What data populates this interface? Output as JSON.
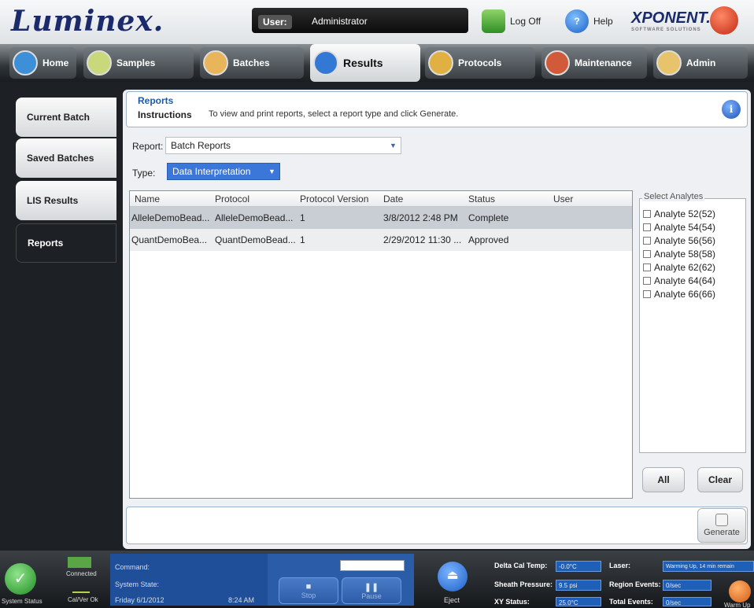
{
  "app": {
    "logo": "Luminex.",
    "xponent": "XPONENT.",
    "xponent_sub": "SOFTWARE SOLUTIONS"
  },
  "header": {
    "user_label": "User:",
    "user_value": "Administrator",
    "logoff": "Log Off",
    "help": "Help"
  },
  "nav": {
    "tabs": [
      {
        "label": "Home",
        "icon": "home-icon"
      },
      {
        "label": "Samples",
        "icon": "samples-icon"
      },
      {
        "label": "Batches",
        "icon": "batches-icon"
      },
      {
        "label": "Results",
        "icon": "results-chart-icon"
      },
      {
        "label": "Protocols",
        "icon": "protocols-icon"
      },
      {
        "label": "Maintenance",
        "icon": "maintenance-tools-icon"
      },
      {
        "label": "Admin",
        "icon": "admin-user-icon"
      }
    ]
  },
  "sidebar": {
    "items": [
      {
        "label": "Current Batch"
      },
      {
        "label": "Saved Batches"
      },
      {
        "label": "LIS Results"
      },
      {
        "label": "Reports"
      }
    ]
  },
  "page": {
    "title": "Reports",
    "instructions_label": "Instructions",
    "instructions_text": "To view and print reports, select a report type and click Generate.",
    "report_label": "Report:",
    "report_value": "Batch Reports",
    "type_label": "Type:",
    "type_value": "Data Interpretation"
  },
  "table": {
    "columns": [
      "Name",
      "Protocol",
      "Protocol Version",
      "Date",
      "Status",
      "User"
    ],
    "rows": [
      {
        "name": "AlleleDemoBead...",
        "protocol": "AlleleDemoBead...",
        "version": "1",
        "date": "3/8/2012 2:48 PM",
        "status": "Complete",
        "user": ""
      },
      {
        "name": "QuantDemoBea...",
        "protocol": "QuantDemoBead...",
        "version": "1",
        "date": "2/29/2012 11:30 ...",
        "status": "Approved",
        "user": ""
      }
    ]
  },
  "analytes": {
    "title": "Select Analytes",
    "items": [
      "Analyte 52(52)",
      "Analyte 54(54)",
      "Analyte 56(56)",
      "Analyte 58(58)",
      "Analyte 62(62)",
      "Analyte 64(64)",
      "Analyte 66(66)"
    ],
    "all_label": "All",
    "clear_label": "Clear"
  },
  "generate_label": "Generate",
  "statusbar": {
    "system_status": "System Status",
    "connected": "Connected",
    "calver": "Cal/Ver Ok",
    "command_label": "Command:",
    "state_label": "System State:",
    "date": "Friday 6/1/2012",
    "time": "8:24 AM",
    "stop": "Stop",
    "pause": "Pause",
    "eject": "Eject",
    "delta_cal_label": "Delta Cal Temp:",
    "delta_cal_value": "-0.0°C",
    "sheath_label": "Sheath Pressure:",
    "sheath_value": "9.5 psi",
    "xy_label": "XY Status:",
    "xy_value": "25.0°C",
    "laser_label": "Laser:",
    "laser_value": "Warming Up, 14 min remain",
    "region_label": "Region Events:",
    "region_value": "0/sec",
    "total_label": "Total Events:",
    "total_value": "0/sec",
    "warmup": "Warm Up"
  },
  "colors": {
    "accent": "#1e5fb7",
    "nav_dark": "#1d2024",
    "title_blue": "#1d5aa6"
  }
}
